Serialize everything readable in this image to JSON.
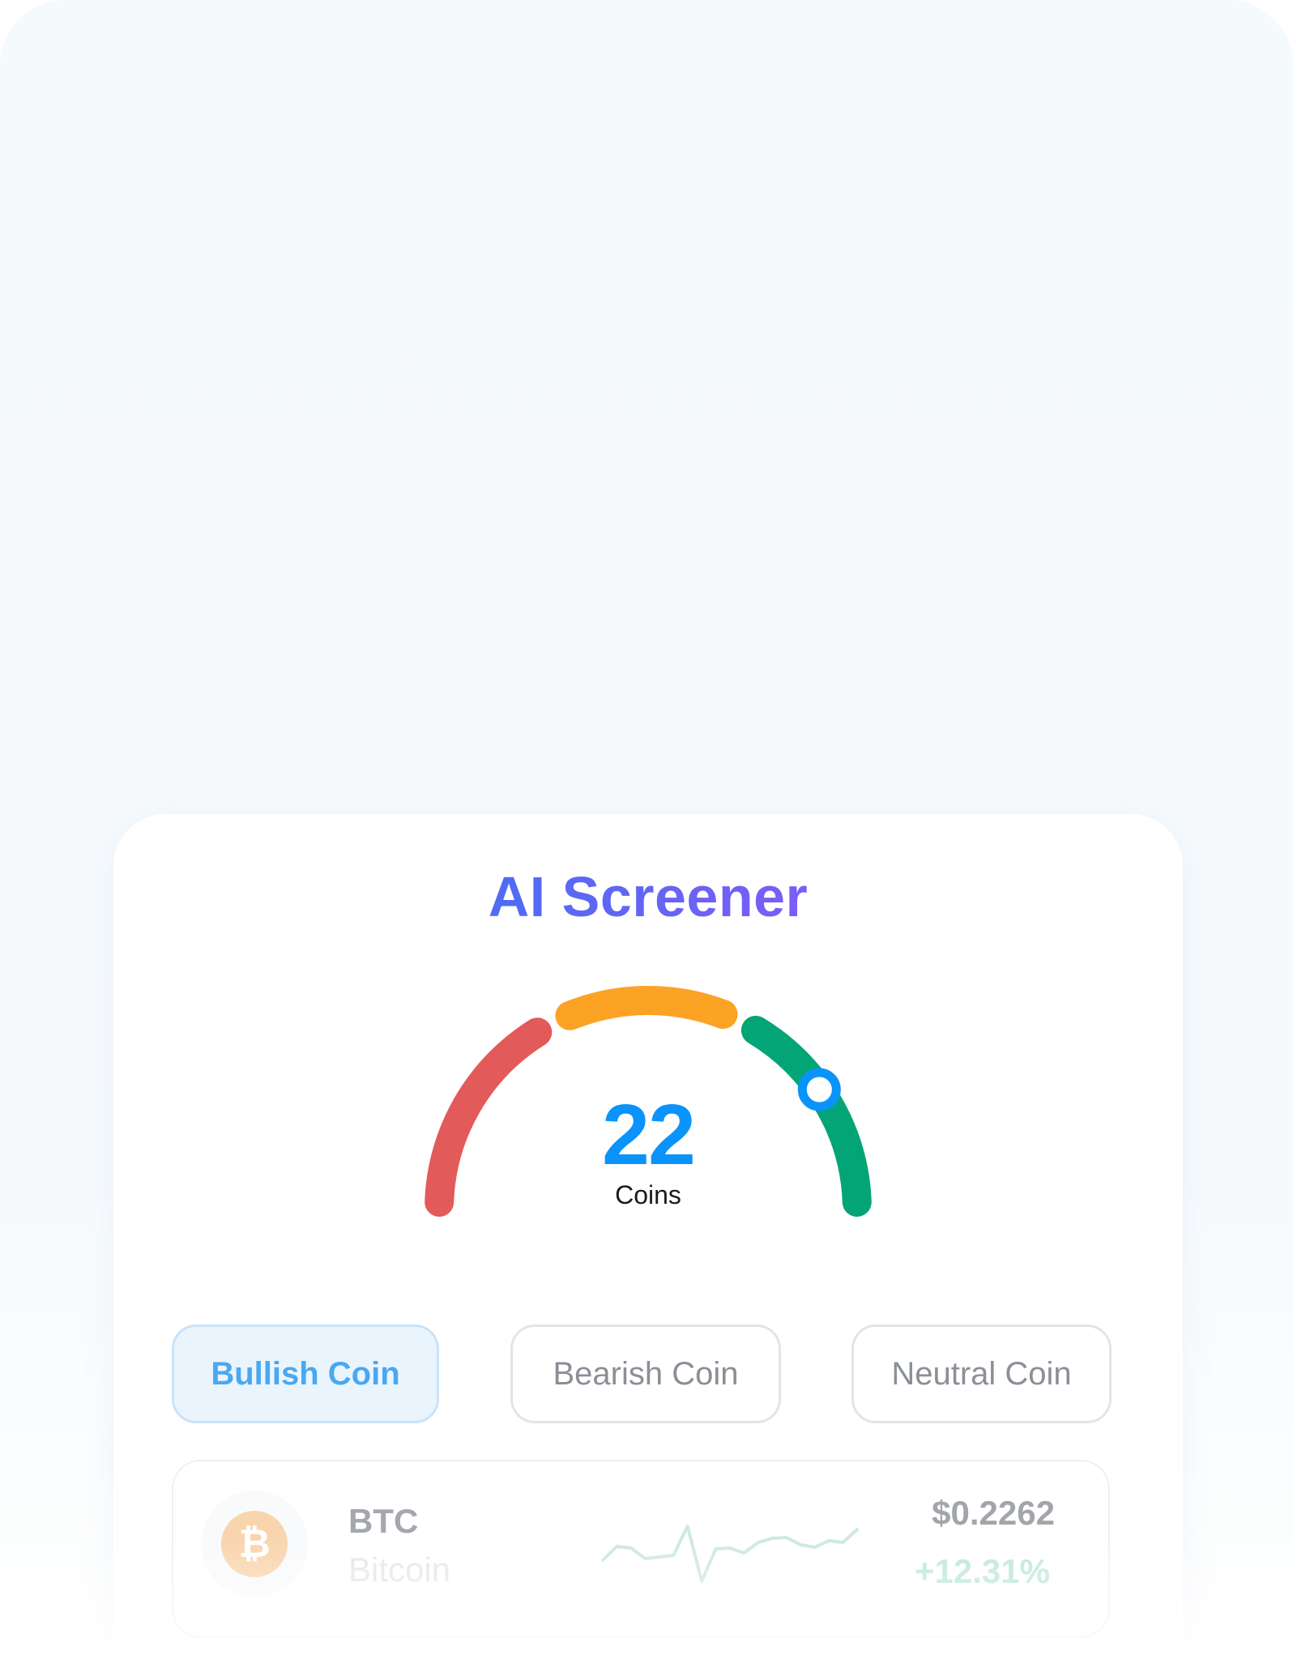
{
  "screener": {
    "title": "AI Screener",
    "count": "22",
    "count_label": "Coins",
    "gauge_segment_colors": [
      "#e35a5a",
      "#fca224",
      "#03a576"
    ],
    "indicator_color": "#0a93fb"
  },
  "tabs": [
    {
      "label": "Bullish Coin",
      "active": true
    },
    {
      "label": "Bearish Coin",
      "active": false
    },
    {
      "label": "Neutral Coin",
      "active": false
    }
  ],
  "coin_row": {
    "icon": "bitcoin-icon",
    "icon_glyph": "₿",
    "symbol": "BTC",
    "name": "Bitcoin",
    "price": "$0.2262",
    "change": "+12.31%",
    "sparkline_color": "#cfe9df",
    "sparkline": [
      62,
      45,
      47,
      60,
      58,
      56,
      20,
      88,
      48,
      47,
      53,
      40,
      35,
      34,
      43,
      46,
      38,
      40,
      24
    ]
  }
}
